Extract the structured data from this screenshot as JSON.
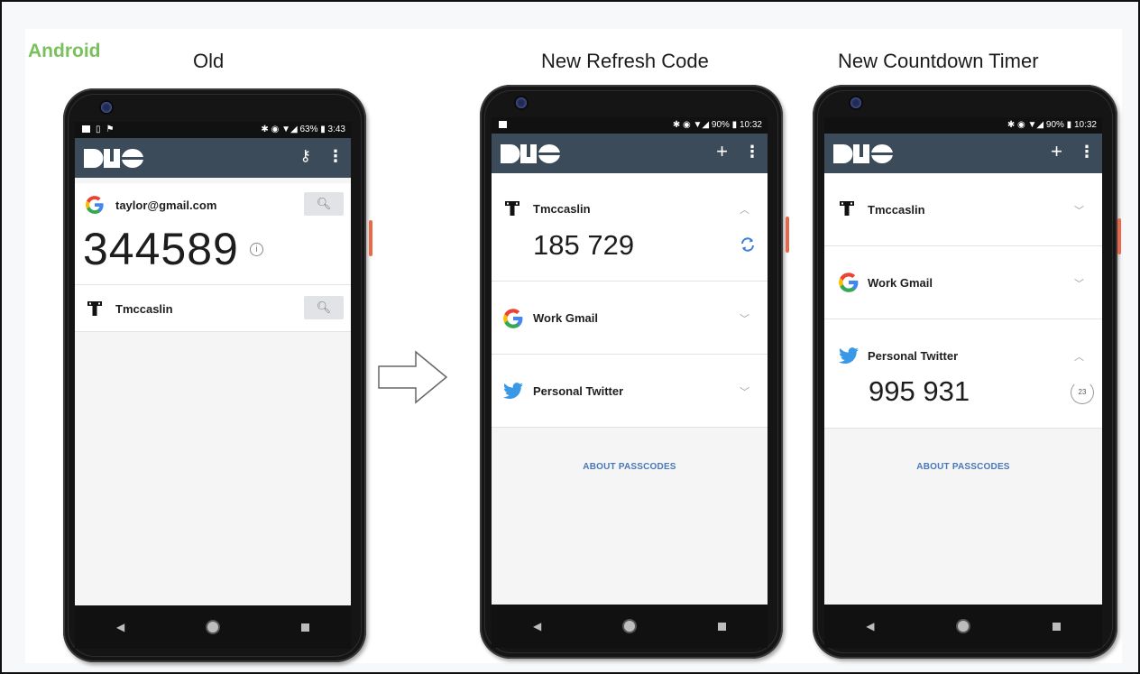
{
  "labels": {
    "platform": "Android",
    "old": "Old",
    "refresh": "New Refresh Code",
    "countdown": "New Countdown Timer"
  },
  "old_phone": {
    "status_right": "63% ▮ 3:43",
    "accounts": [
      {
        "name": "taylor@gmail.com",
        "icon": "google-icon",
        "code": "344589"
      },
      {
        "name": "Tmccaslin",
        "icon": "t-logo-icon"
      }
    ]
  },
  "refresh_phone": {
    "status_right": "90% ▮ 10:32",
    "accounts": [
      {
        "name": "Tmccaslin",
        "icon": "t-logo-icon",
        "code": "185 729",
        "expanded": true
      },
      {
        "name": "Work Gmail",
        "icon": "google-icon"
      },
      {
        "name": "Personal Twitter",
        "icon": "twitter-icon"
      }
    ],
    "about": "ABOUT PASSCODES"
  },
  "countdown_phone": {
    "status_right": "90% ▮ 10:32",
    "accounts": [
      {
        "name": "Tmccaslin",
        "icon": "t-logo-icon"
      },
      {
        "name": "Work Gmail",
        "icon": "google-icon"
      },
      {
        "name": "Personal Twitter",
        "icon": "twitter-icon",
        "code": "995 931",
        "expanded": true,
        "timer": "23"
      }
    ],
    "about": "ABOUT PASSCODES"
  },
  "colors": {
    "appbar": "#3b4b5a",
    "android_label": "#79c15d",
    "link": "#4a78b8",
    "side_button": "#e8694a"
  }
}
